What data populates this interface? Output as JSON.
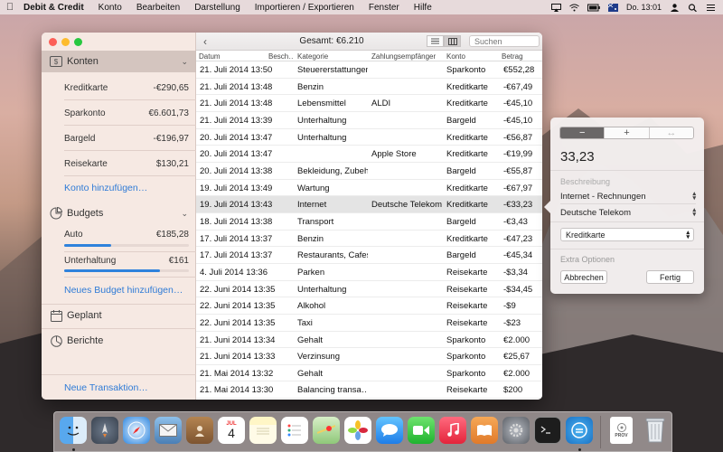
{
  "menubar": {
    "app_name": "Debit & Credit",
    "menus": [
      "Konto",
      "Bearbeiten",
      "Darstellung",
      "Importieren / Exportieren",
      "Fenster",
      "Hilfe"
    ],
    "clock": "Do. 13:01"
  },
  "sidebar": {
    "accounts_header": "Konten",
    "accounts": [
      {
        "name": "Kreditkarte",
        "balance": "-€290,65"
      },
      {
        "name": "Sparkonto",
        "balance": "€6.601,73"
      },
      {
        "name": "Bargeld",
        "balance": "-€196,97"
      },
      {
        "name": "Reisekarte",
        "balance": "$130,21"
      }
    ],
    "add_account": "Konto hinzufügen…",
    "budgets_header": "Budgets",
    "budgets": [
      {
        "name": "Auto",
        "amount": "€185,28",
        "progress": 0.38
      },
      {
        "name": "Unterhaltung",
        "amount": "€161",
        "progress": 0.77
      }
    ],
    "add_budget": "Neues Budget hinzufügen…",
    "scheduled": "Geplant",
    "reports": "Berichte",
    "new_transaction": "Neue Transaktion…"
  },
  "toolbar": {
    "total": "Gesamt: €6.210",
    "search_placeholder": "Suchen"
  },
  "table": {
    "headers": {
      "date": "Datum",
      "desc": "Besch…",
      "category": "Kategorie",
      "payee": "Zahlungsempfänger",
      "account": "Konto",
      "amount": "Betrag"
    },
    "rows": [
      {
        "date": "21. Juli 2014 13:50",
        "category": "Steuererstattungen",
        "payee": "",
        "account": "Sparkonto",
        "amount": "€552,28"
      },
      {
        "date": "21. Juli 2014 13:48",
        "category": "Benzin",
        "payee": "",
        "account": "Kreditkarte",
        "amount": "-€67,49"
      },
      {
        "date": "21. Juli 2014 13:48",
        "category": "Lebensmittel",
        "payee": "ALDI",
        "account": "Kreditkarte",
        "amount": "-€45,10"
      },
      {
        "date": "21. Juli 2014 13:39",
        "category": "Unterhaltung",
        "payee": "",
        "account": "Bargeld",
        "amount": "-€45,10"
      },
      {
        "date": "20. Juli 2014 13:47",
        "category": "Unterhaltung",
        "payee": "",
        "account": "Kreditkarte",
        "amount": "-€56,87"
      },
      {
        "date": "20. Juli 2014 13:47",
        "category": "",
        "payee": "Apple Store",
        "account": "Kreditkarte",
        "amount": "-€19,99"
      },
      {
        "date": "20. Juli 2014 13:38",
        "category": "Bekleidung, Zubehör",
        "payee": "",
        "account": "Bargeld",
        "amount": "-€55,87"
      },
      {
        "date": "19. Juli 2014 13:49",
        "category": "Wartung",
        "payee": "",
        "account": "Kreditkarte",
        "amount": "-€67,97"
      },
      {
        "date": "19. Juli 2014 13:43",
        "category": "Internet",
        "payee": "Deutsche Telekom",
        "account": "Kreditkarte",
        "amount": "-€33,23"
      },
      {
        "date": "18. Juli 2014 13:38",
        "category": "Transport",
        "payee": "",
        "account": "Bargeld",
        "amount": "-€3,43"
      },
      {
        "date": "17. Juli 2014 13:37",
        "category": "Benzin",
        "payee": "",
        "account": "Kreditkarte",
        "amount": "-€47,23"
      },
      {
        "date": "17. Juli 2014 13:37",
        "category": "Restaurants, Cafes",
        "payee": "",
        "account": "Bargeld",
        "amount": "-€45,34"
      },
      {
        "date": "4. Juli 2014 13:36",
        "category": "Parken",
        "payee": "",
        "account": "Reisekarte",
        "amount": "-$3,34"
      },
      {
        "date": "22. Juni 2014 13:35",
        "category": "Unterhaltung",
        "payee": "",
        "account": "Reisekarte",
        "amount": "-$34,45"
      },
      {
        "date": "22. Juni 2014 13:35",
        "category": "Alkohol",
        "payee": "",
        "account": "Reisekarte",
        "amount": "-$9"
      },
      {
        "date": "22. Juni 2014 13:35",
        "category": "Taxi",
        "payee": "",
        "account": "Reisekarte",
        "amount": "-$23"
      },
      {
        "date": "21. Juni 2014 13:34",
        "category": "Gehalt",
        "payee": "",
        "account": "Sparkonto",
        "amount": "€2.000"
      },
      {
        "date": "21. Juni 2014 13:33",
        "category": "Verzinsung",
        "payee": "",
        "account": "Sparkonto",
        "amount": "€25,67"
      },
      {
        "date": "21. Mai 2014 13:32",
        "category": "Gehalt",
        "payee": "",
        "account": "Sparkonto",
        "amount": "€2.000"
      },
      {
        "date": "21. Mai 2014 13:30",
        "category": "Balancing transa…",
        "payee": "",
        "account": "Reisekarte",
        "amount": "$200"
      }
    ],
    "selected_index": 8
  },
  "popover": {
    "seg_minus": "−",
    "seg_plus": "+",
    "seg_transfer": "↔",
    "amount": "33,23",
    "description_placeholder": "Beschreibung",
    "category": "Internet - Rechnungen",
    "payee": "Deutsche Telekom",
    "account": "Kreditkarte",
    "extra_options": "Extra Optionen",
    "cancel": "Abbrechen",
    "done": "Fertig"
  },
  "dock": {
    "calendar_month": "JUL",
    "calendar_day": "4",
    "preview_label": "PROV"
  },
  "colors": {
    "accent": "#2f7bd6",
    "sidebar_bg": "#f6e8e2",
    "selected_row": "#e4e4e4"
  }
}
